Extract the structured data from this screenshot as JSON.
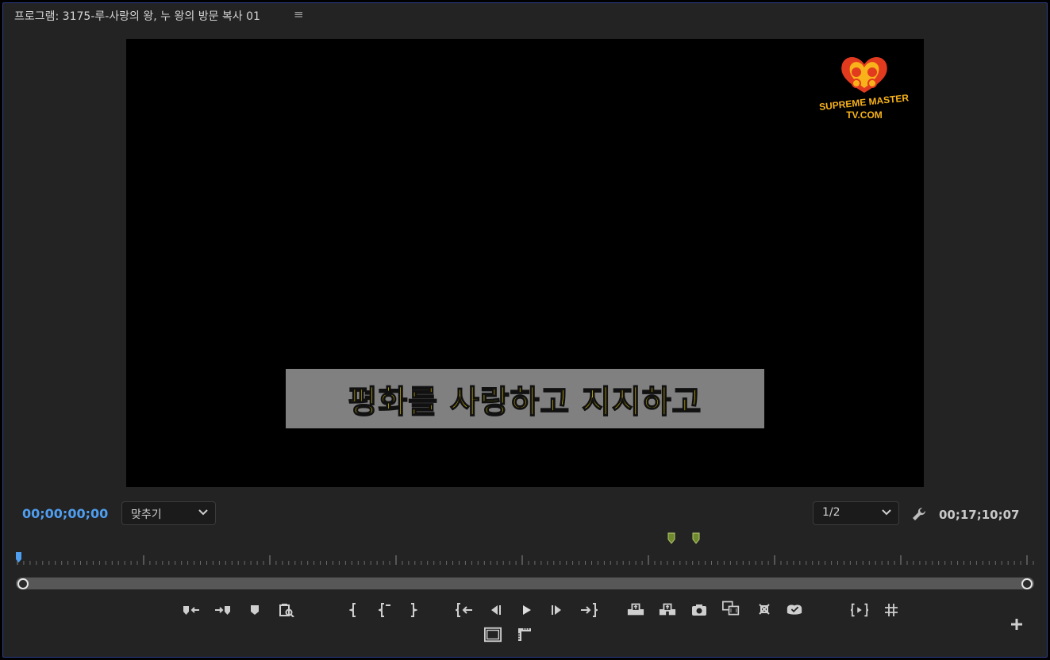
{
  "panel": {
    "title": "프로그램: 3175-루-사랑의 왕, 누 왕의 방문 복사 01",
    "menu_icon": "hamburger-icon"
  },
  "video": {
    "caption": "평화를 사랑하고 지지하고",
    "logo_text_line1": "SUPREME MASTER",
    "logo_text_line2": "TV.COM"
  },
  "timecode": {
    "current": "00;00;00;00",
    "duration": "00;17;10;07"
  },
  "zoom_dropdown": {
    "selected": "맞추기"
  },
  "resolution_dropdown": {
    "selected": "1/2"
  },
  "colors": {
    "accent_blue": "#4f9ef0",
    "caption_yellow": "#ffe300",
    "caption_bg": "#808080",
    "marker_green": "#6f8a2e",
    "panel_bg": "#232323"
  },
  "controls_row1": [
    "add-marker-in-icon",
    "add-marker-out-icon",
    "add-marker-icon",
    "match-frame-zoom-icon",
    "mark-in-icon",
    "mark-out-left-icon",
    "mark-out-icon",
    "go-to-in-icon",
    "step-back-icon",
    "play-icon",
    "step-forward-icon",
    "go-to-out-icon",
    "lift-icon",
    "extract-icon",
    "export-frame-icon",
    "comparison-view-icon",
    "toggle-proxies-icon",
    "vr-video-icon",
    "trim-icon",
    "safe-margins-icon"
  ],
  "controls_row2": [
    "multi-camera-icon",
    "show-rulers-icon"
  ],
  "add_button_icon": "plus-icon"
}
